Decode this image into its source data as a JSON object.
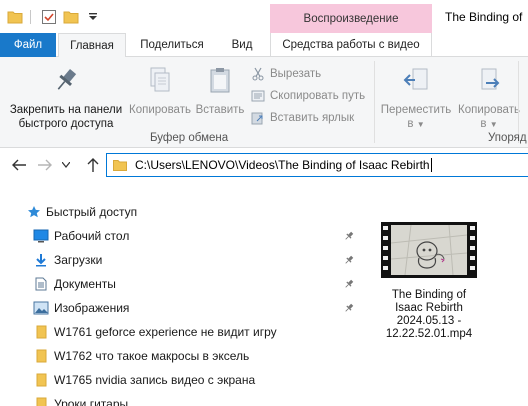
{
  "titlebar": {
    "context_tab_header": "Воспроизведение",
    "window_title": "The Binding of"
  },
  "ribbon_tabs": {
    "file": "Файл",
    "home": "Главная",
    "share": "Поделиться",
    "view": "Вид",
    "video_tools": "Средства работы с видео"
  },
  "ribbon": {
    "pin_label_1": "Закрепить на панели",
    "pin_label_2": "быстрого доступа",
    "copy": "Копировать",
    "paste": "Вставить",
    "cut": "Вырезать",
    "copy_path": "Скопировать путь",
    "paste_shortcut": "Вставить ярлык",
    "clipboard_group": "Буфер обмена",
    "move_to_1": "Переместить",
    "move_to_2": "в",
    "copy_to_1": "Копировать",
    "copy_to_2": "в",
    "organize_group": "Упоряд"
  },
  "address": {
    "path": "C:\\Users\\LENOVO\\Videos\\The Binding of Isaac  Rebirth"
  },
  "nav_pane": {
    "quick_access": "Быстрый доступ",
    "items": [
      {
        "label": "Рабочий стол",
        "icon": "desktop-icon",
        "pinned": true
      },
      {
        "label": "Загрузки",
        "icon": "download-icon",
        "pinned": true
      },
      {
        "label": "Документы",
        "icon": "document-icon",
        "pinned": true
      },
      {
        "label": "Изображения",
        "icon": "pictures-icon",
        "pinned": true
      },
      {
        "label": "W1761 geforce experience не видит игру",
        "icon": "folder-icon",
        "pinned": false
      },
      {
        "label": "W1762 что такое макросы в эксель",
        "icon": "folder-icon",
        "pinned": false
      },
      {
        "label": "W1765 nvidia запись видео с экрана",
        "icon": "folder-icon",
        "pinned": false
      },
      {
        "label": "Уроки гитары",
        "icon": "folder-icon",
        "pinned": false
      }
    ]
  },
  "files": [
    {
      "name_line1": "The Binding of",
      "name_line2": "Isaac  Rebirth",
      "name_line3": "2024.05.13 -",
      "name_line4": "12.22.52.01.mp4"
    }
  ],
  "colors": {
    "file_tab": "#1979ca",
    "context_tab": "#f7c7dc",
    "address_border": "#0078d7",
    "folder": "#f1c452"
  }
}
